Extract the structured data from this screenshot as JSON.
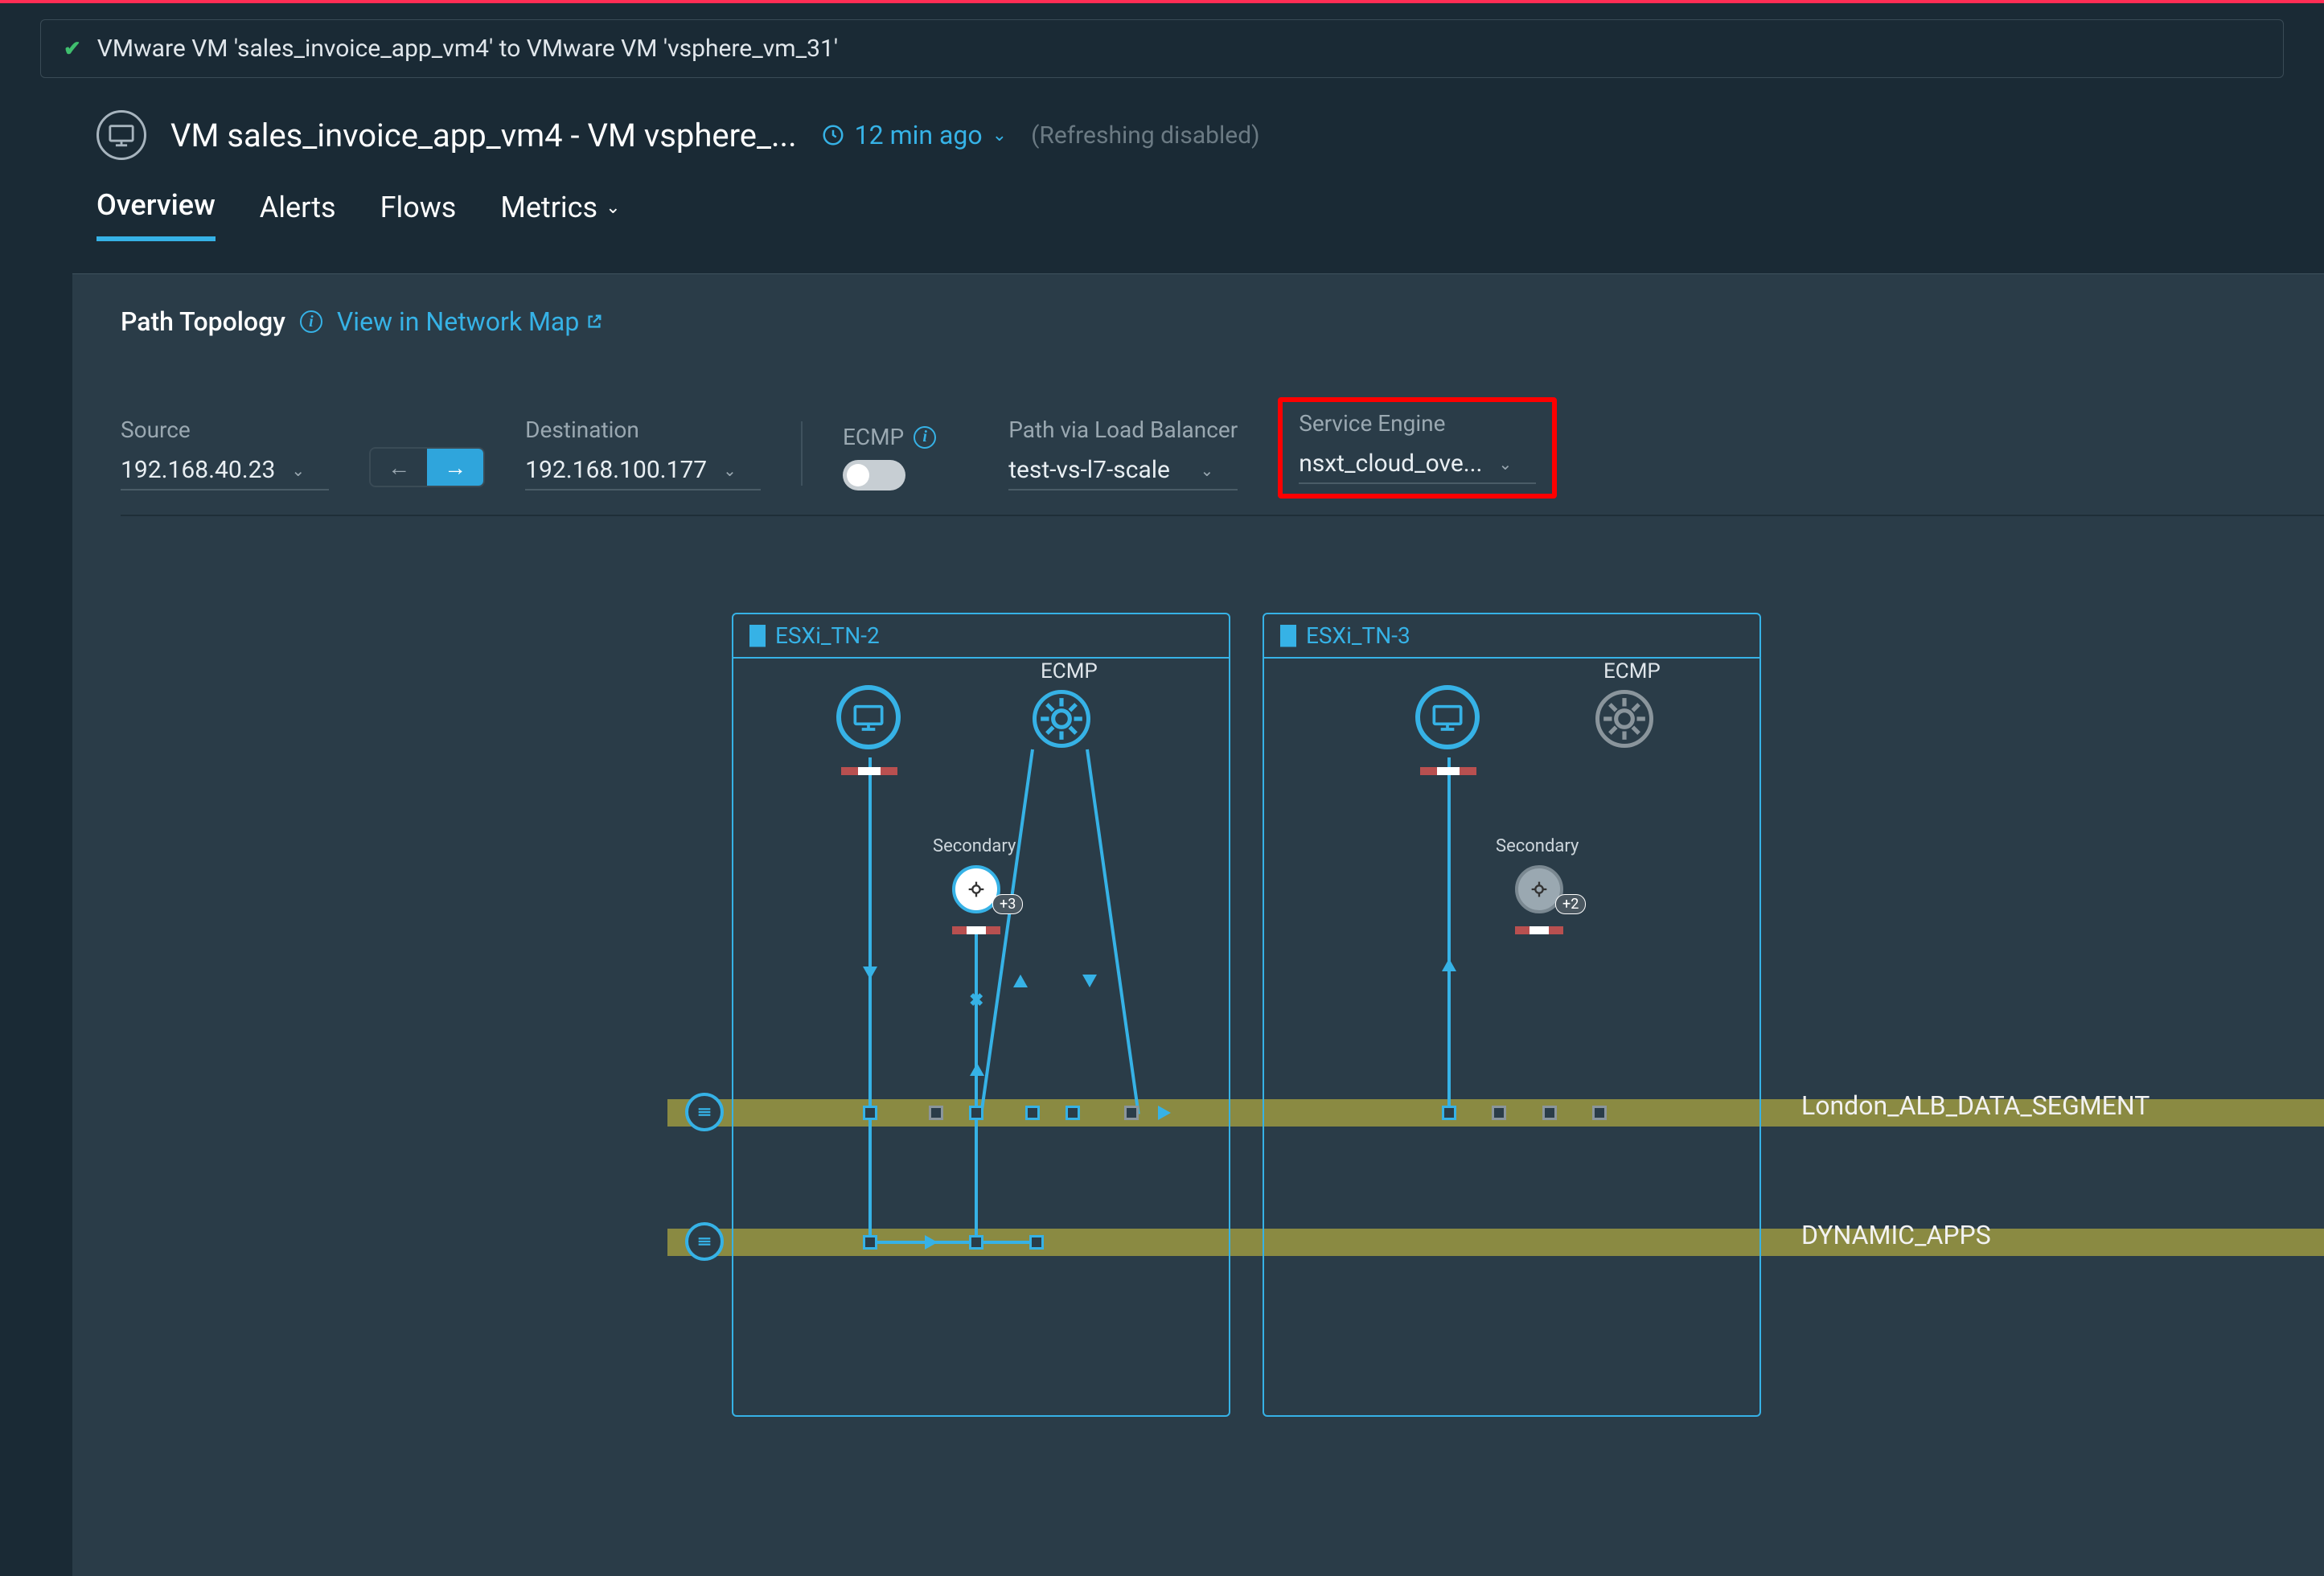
{
  "breadcrumb": {
    "text": "VMware VM 'sales_invoice_app_vm4' to VMware VM 'vsphere_vm_31'"
  },
  "header": {
    "title": "VM sales_invoice_app_vm4 - VM vsphere_...",
    "time_ago": "12 min ago",
    "refresh_note": "(Refreshing  disabled)"
  },
  "tabs": {
    "overview": "Overview",
    "alerts": "Alerts",
    "flows": "Flows",
    "metrics": "Metrics"
  },
  "panel": {
    "title": "Path Topology",
    "map_link": "View in Network Map"
  },
  "controls": {
    "source_label": "Source",
    "source_value": "192.168.40.23",
    "dest_label": "Destination",
    "dest_value": "192.168.100.177",
    "ecmp_label": "ECMP",
    "path_lb_label": "Path via Load Balancer",
    "path_lb_value": "test-vs-l7-scale",
    "se_label": "Service Engine",
    "se_value": "nsxt_cloud_ove..."
  },
  "topology": {
    "host1": "ESXi_TN-2",
    "host2": "ESXi_TN-3",
    "ecmp_label": "ECMP",
    "secondary_label": "Secondary",
    "badge1": "+3",
    "badge2": "+2",
    "segment1": "London_ALB_DATA_SEGMENT",
    "segment2": "DYNAMIC_APPS"
  }
}
